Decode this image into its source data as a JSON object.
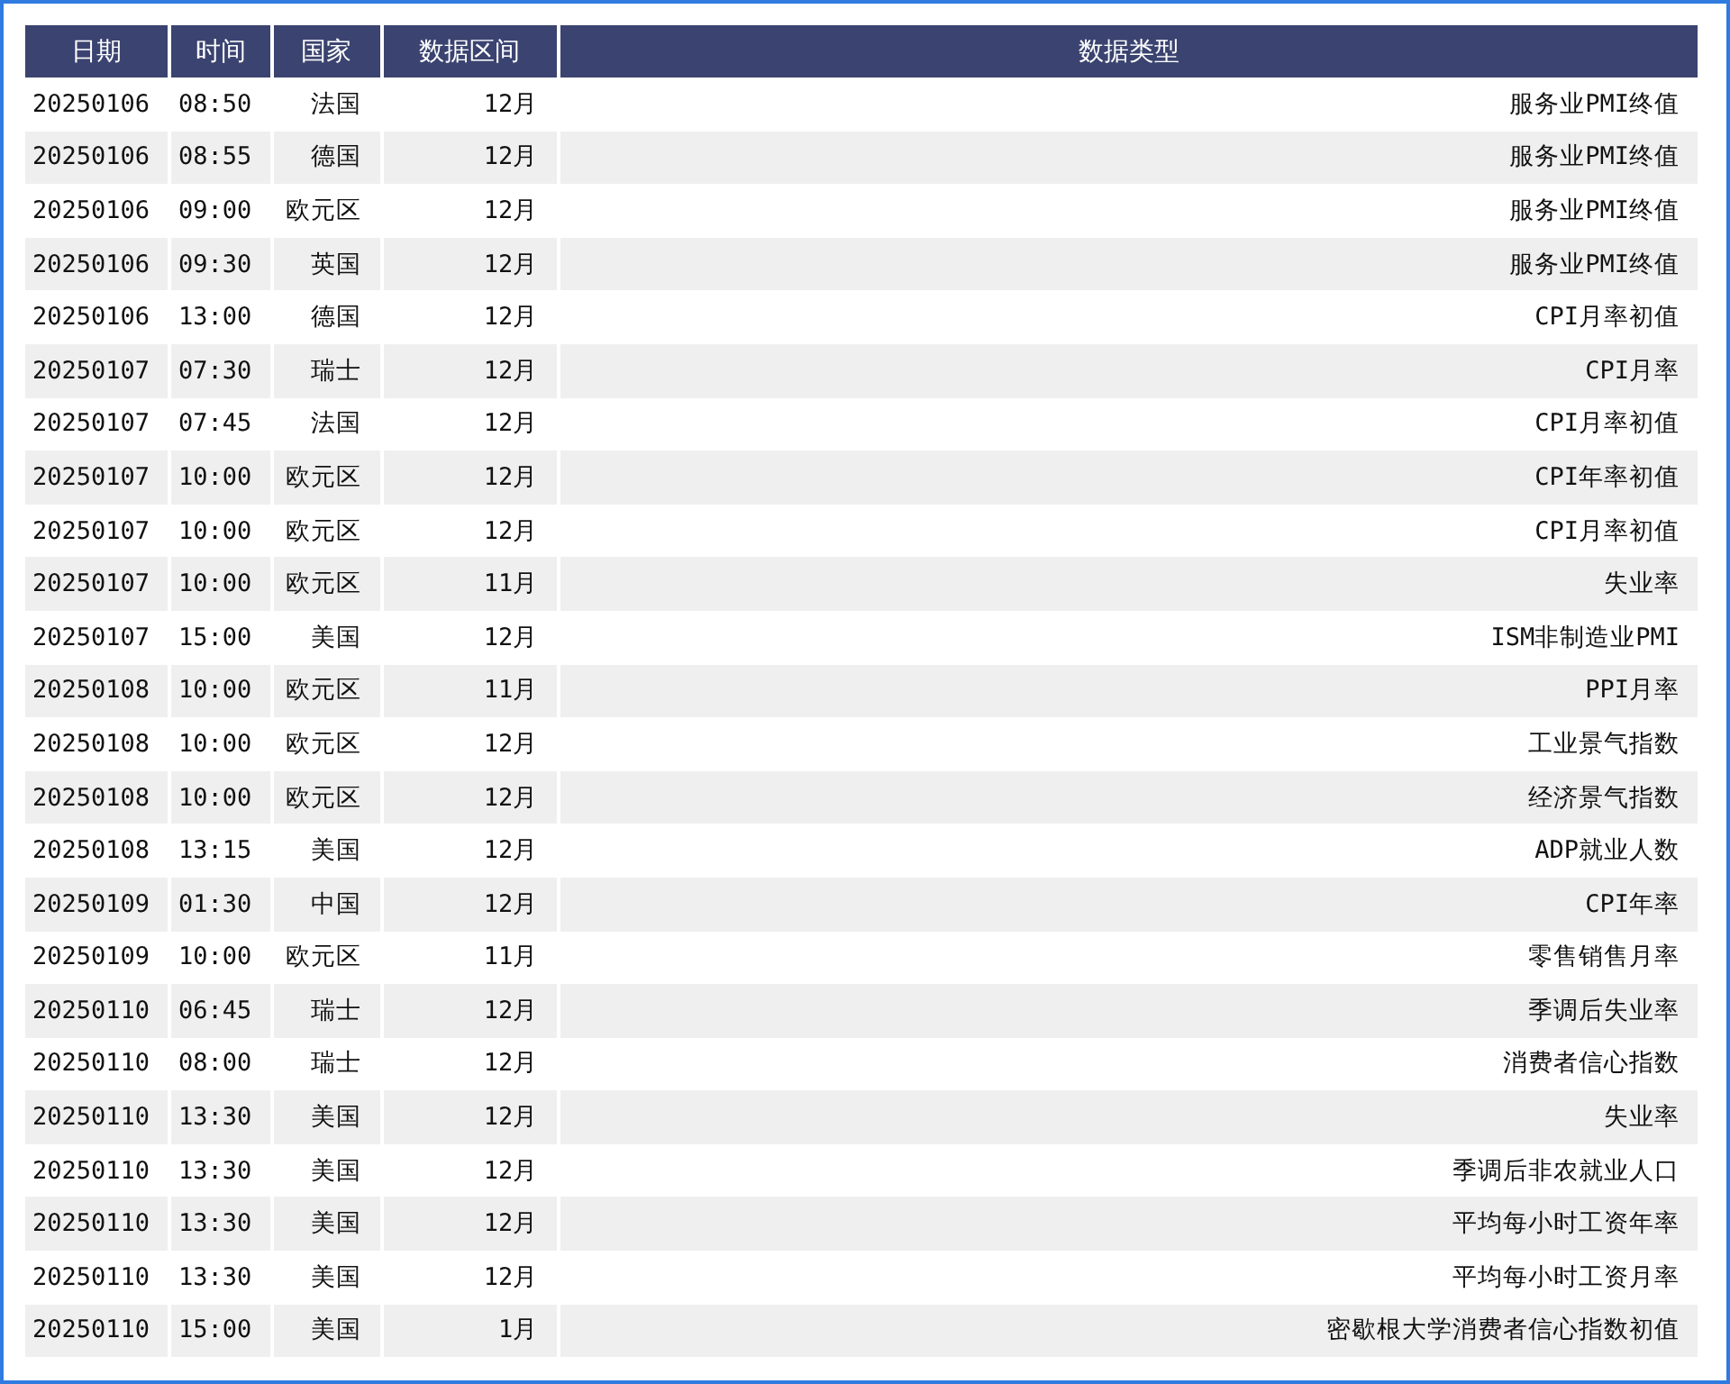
{
  "table": {
    "columns": [
      "日期",
      "时间",
      "国家",
      "数据区间",
      "数据类型"
    ],
    "rows": [
      [
        "20250106",
        "08:50",
        "法国",
        "12月",
        "服务业PMI终值"
      ],
      [
        "20250106",
        "08:55",
        "德国",
        "12月",
        "服务业PMI终值"
      ],
      [
        "20250106",
        "09:00",
        "欧元区",
        "12月",
        "服务业PMI终值"
      ],
      [
        "20250106",
        "09:30",
        "英国",
        "12月",
        "服务业PMI终值"
      ],
      [
        "20250106",
        "13:00",
        "德国",
        "12月",
        "CPI月率初值"
      ],
      [
        "20250107",
        "07:30",
        "瑞士",
        "12月",
        "CPI月率"
      ],
      [
        "20250107",
        "07:45",
        "法国",
        "12月",
        "CPI月率初值"
      ],
      [
        "20250107",
        "10:00",
        "欧元区",
        "12月",
        "CPI年率初值"
      ],
      [
        "20250107",
        "10:00",
        "欧元区",
        "12月",
        "CPI月率初值"
      ],
      [
        "20250107",
        "10:00",
        "欧元区",
        "11月",
        "失业率"
      ],
      [
        "20250107",
        "15:00",
        "美国",
        "12月",
        "ISM非制造业PMI"
      ],
      [
        "20250108",
        "10:00",
        "欧元区",
        "11月",
        "PPI月率"
      ],
      [
        "20250108",
        "10:00",
        "欧元区",
        "12月",
        "工业景气指数"
      ],
      [
        "20250108",
        "10:00",
        "欧元区",
        "12月",
        "经济景气指数"
      ],
      [
        "20250108",
        "13:15",
        "美国",
        "12月",
        "ADP就业人数"
      ],
      [
        "20250109",
        "01:30",
        "中国",
        "12月",
        "CPI年率"
      ],
      [
        "20250109",
        "10:00",
        "欧元区",
        "11月",
        "零售销售月率"
      ],
      [
        "20250110",
        "06:45",
        "瑞士",
        "12月",
        "季调后失业率"
      ],
      [
        "20250110",
        "08:00",
        "瑞士",
        "12月",
        "消费者信心指数"
      ],
      [
        "20250110",
        "13:30",
        "美国",
        "12月",
        "失业率"
      ],
      [
        "20250110",
        "13:30",
        "美国",
        "12月",
        "季调后非农就业人口"
      ],
      [
        "20250110",
        "13:30",
        "美国",
        "12月",
        "平均每小时工资年率"
      ],
      [
        "20250110",
        "13:30",
        "美国",
        "12月",
        "平均每小时工资月率"
      ],
      [
        "20250110",
        "15:00",
        "美国",
        "1月",
        "密歇根大学消费者信心指数初值"
      ]
    ]
  }
}
